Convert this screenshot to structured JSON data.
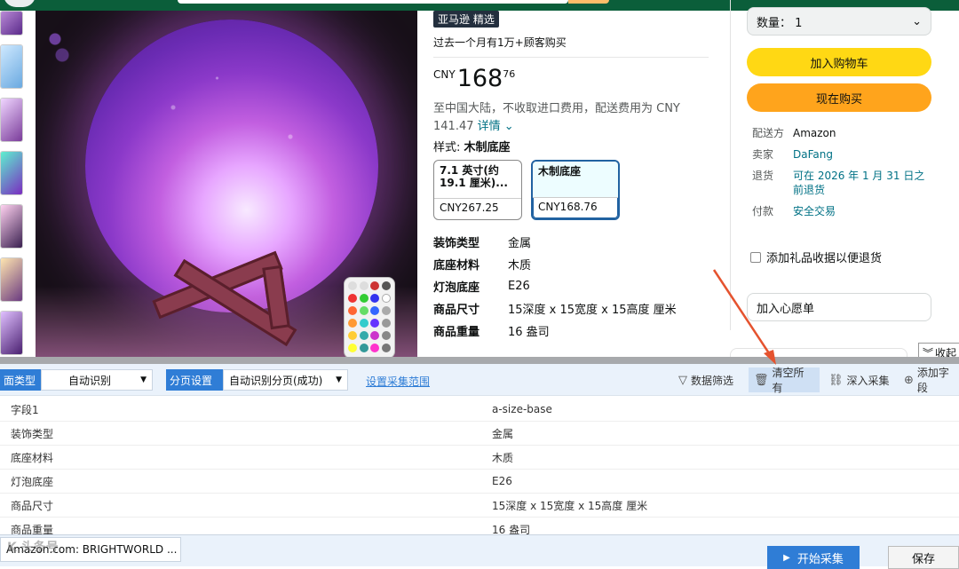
{
  "product": {
    "badge": "亚马逊 精选",
    "bought": "过去一个月有1万+顾客购买",
    "price": {
      "currency": "CNY",
      "whole": "168",
      "fraction": "76"
    },
    "shipping": "至中国大陆，不收取进口费用，配送费用为 CNY 141.47",
    "details_link": "详情",
    "style_label": "样式:",
    "style_value": "木制底座",
    "swatches": [
      {
        "title": "7.1 英寸(约 19.1 厘米)...",
        "price": "CNY267.25",
        "selected": false
      },
      {
        "title": "木制底座",
        "price": "CNY168.76",
        "selected": true
      }
    ],
    "specs": [
      {
        "key": "装饰类型",
        "value": "金属"
      },
      {
        "key": "底座材料",
        "value": "木质"
      },
      {
        "key": "灯泡底座",
        "value": "E26"
      },
      {
        "key": "商品尺寸",
        "value": "15深度 x 15宽度 x 15高度 厘米"
      },
      {
        "key": "商品重量",
        "value": "16 盎司"
      }
    ]
  },
  "buybox": {
    "qty_label": "数量：",
    "qty_value": "1",
    "add_to_cart": "加入购物车",
    "buy_now": "现在购买",
    "meta": [
      {
        "key": "配送方",
        "value": "Amazon",
        "link": false
      },
      {
        "key": "卖家",
        "value": "DaFang",
        "link": true
      },
      {
        "key": "退货",
        "value": "可在 2026 年 1 月 31 日之前退货",
        "link": true
      },
      {
        "key": "付款",
        "value": "安全交易",
        "link": true
      }
    ],
    "gift_label": "添加礼品收据以便退货",
    "wishlist": "加入心愿单",
    "collapse": "收起"
  },
  "toolbar": {
    "page_type_label": "面类型",
    "page_type_value": "自动识别",
    "pagination_label": "分页设置",
    "pagination_value": "自动识别分页(成功)",
    "scope_link": "设置采集范围",
    "filter": "数据筛选",
    "clear_all": "清空所有",
    "deep_collect": "深入采集",
    "add_field": "添加字段"
  },
  "table": {
    "rows": [
      {
        "field": "字段1",
        "value": "a-size-base"
      },
      {
        "field": "装饰类型",
        "value": "金属"
      },
      {
        "field": "底座材料",
        "value": "木质"
      },
      {
        "field": "灯泡底座",
        "value": "E26"
      },
      {
        "field": "商品尺寸",
        "value": "15深度 x 15宽度 x 15高度 厘米"
      },
      {
        "field": "商品重量",
        "value": "16 盎司"
      }
    ]
  },
  "footer": {
    "url": "Amazon.com: BRIGHTWORLD ...",
    "start": "开始采集",
    "save": "保存",
    "watermark": "K 头条号"
  },
  "colors": {
    "accent": "#2f7dd6",
    "cart": "#ffd814",
    "buy": "#ffa41c",
    "annotation": "#e5532f"
  }
}
